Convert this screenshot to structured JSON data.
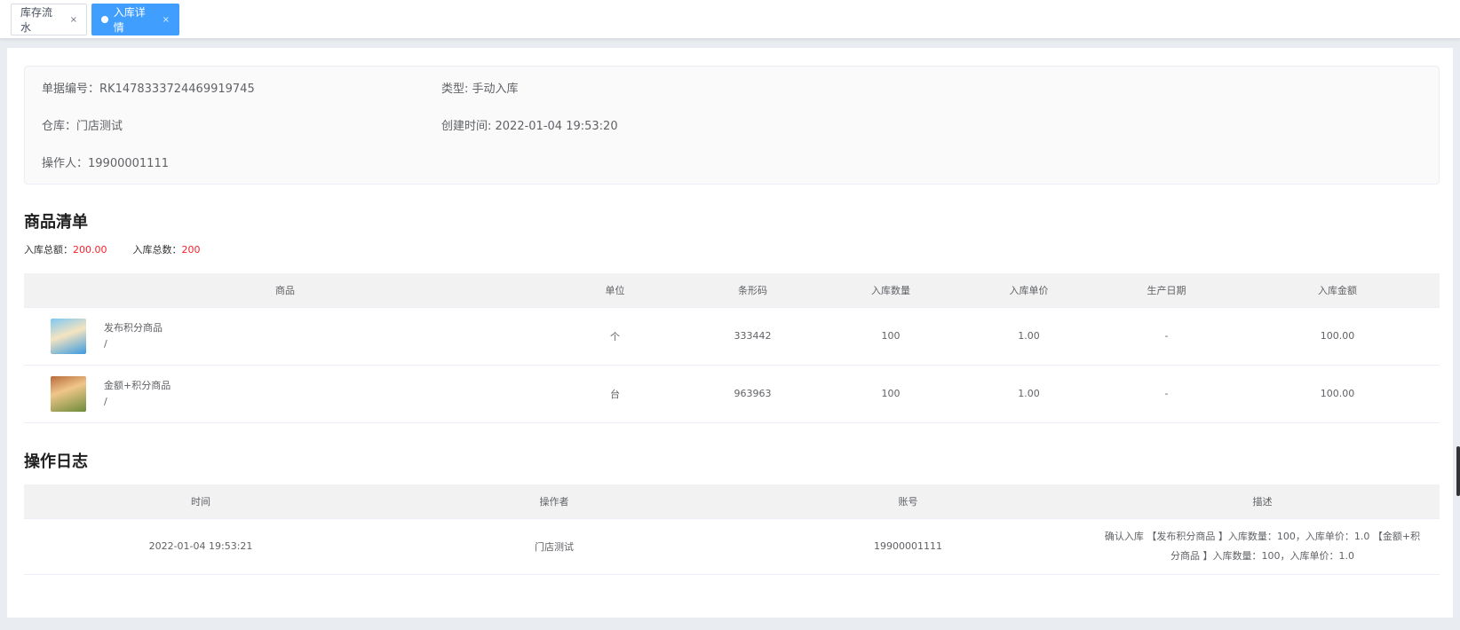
{
  "tabs": [
    {
      "label": "库存流水",
      "close": "×",
      "active": false
    },
    {
      "label": "入库详情",
      "close": "×",
      "active": true
    }
  ],
  "info": {
    "order_no_label": "单据编号：",
    "order_no": "RK1478333724469919745",
    "type_label": "类型: ",
    "type": "手动入库",
    "warehouse_label": "仓库：",
    "warehouse": "门店测试",
    "created_label": "创建时间: ",
    "created": "2022-01-04 19:53:20",
    "operator_label": "操作人：",
    "operator": "19900001111"
  },
  "goods": {
    "title": "商品清单",
    "total_amount_label": "入库总额：",
    "total_amount": "200.00",
    "total_qty_label": "入库总数：",
    "total_qty": "200",
    "headers": [
      "商品",
      "单位",
      "条形码",
      "入库数量",
      "入库单价",
      "生产日期",
      "入库金额"
    ],
    "rows": [
      {
        "name": "发布积分商品",
        "spec": "/",
        "unit": "个",
        "barcode": "333442",
        "qty": "100",
        "price": "1.00",
        "date": "-",
        "amount": "100.00"
      },
      {
        "name": "金额+积分商品",
        "spec": "/",
        "unit": "台",
        "barcode": "963963",
        "qty": "100",
        "price": "1.00",
        "date": "-",
        "amount": "100.00"
      }
    ]
  },
  "log": {
    "title": "操作日志",
    "headers": [
      "时间",
      "操作者",
      "账号",
      "描述"
    ],
    "rows": [
      {
        "time": "2022-01-04 19:53:21",
        "operator": "门店测试",
        "account": "19900001111",
        "desc_line1": "确认入库 【发布积分商品 】入库数量：100，入库单价：1.0 【金额+积",
        "desc_line2": "分商品 】入库数量：100，入库单价：1.0"
      }
    ]
  },
  "colors": {
    "accent": "#409eff",
    "red": "#f5222d"
  }
}
